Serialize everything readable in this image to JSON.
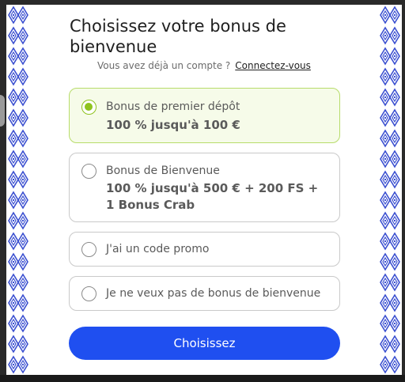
{
  "modal": {
    "title": "Choisissez votre bonus de bienvenue",
    "account_prompt": "Vous avez déjà un compte ?",
    "login_link": "Connectez-vous"
  },
  "options": [
    {
      "label": "Bonus de premier dépôt",
      "value": "100 % jusqu'à 100 €",
      "selected": true
    },
    {
      "label": "Bonus de Bienvenue",
      "value": "100 % jusqu'à 500 € + 200 FS + 1 Bonus Crab",
      "selected": false
    },
    {
      "label": "J'ai un code promo",
      "selected": false
    },
    {
      "label": "Je ne veux pas de bonus de bienvenue",
      "selected": false
    }
  ],
  "cta": {
    "label": "Choisissez"
  },
  "colors": {
    "accent_blue": "#1f4ff0",
    "selected_green": "#8fc31f",
    "selected_border": "#b7dc6a",
    "pattern_blue": "#3a4fd0"
  }
}
